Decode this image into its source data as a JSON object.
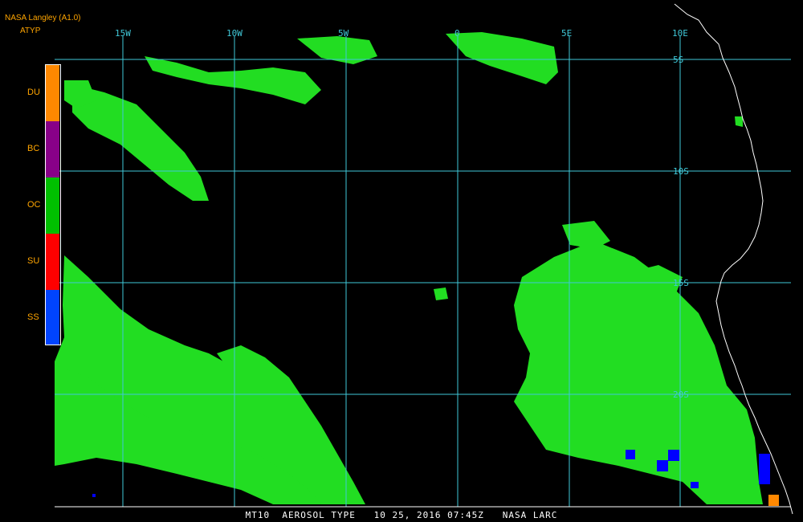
{
  "header": {
    "title": "NASA Langley (A1.0)",
    "subtitle": "ATYP"
  },
  "legend": {
    "items": [
      {
        "label": "DU",
        "color": "#ff8800"
      },
      {
        "label": "BC",
        "color": "#880088"
      },
      {
        "label": "OC",
        "color": "#00c000"
      },
      {
        "label": "SU",
        "color": "#ff0000"
      },
      {
        "label": "SS",
        "color": "#0044ff"
      }
    ]
  },
  "grid": {
    "lon_labels": [
      "15W",
      "10W",
      "5W",
      "0",
      "5E",
      "10E"
    ],
    "lat_labels": [
      "5S",
      "10S",
      "15S",
      "20S"
    ],
    "color": "#40c8d8"
  },
  "footer": {
    "text": "MT10  AEROSOL TYPE   10 25, 2016 07:45Z   NASA LARC"
  },
  "colors": {
    "oc": "#22dd22",
    "ss": "#0000ff",
    "du": "#ff8800",
    "coast": "#ffffff"
  }
}
